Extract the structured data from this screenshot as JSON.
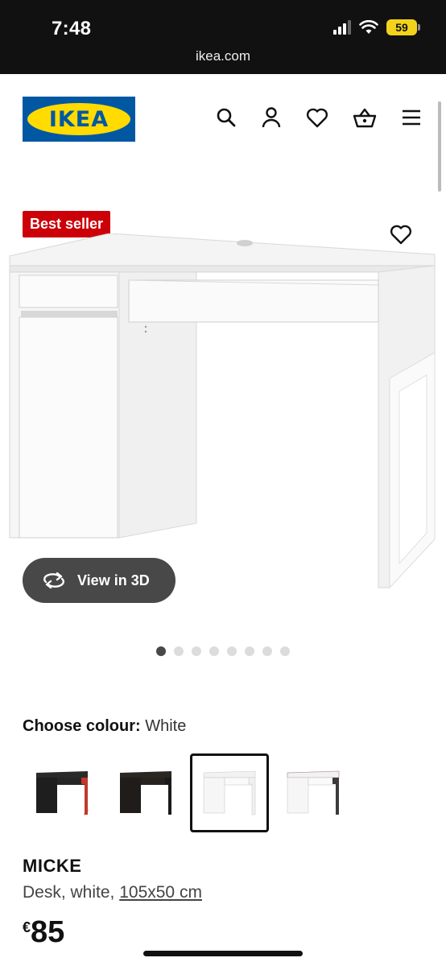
{
  "status_bar": {
    "time": "7:48",
    "battery": "59",
    "url": "ikea.com"
  },
  "header": {
    "logo_text": "IKEA",
    "icons": [
      "search-icon",
      "profile-icon",
      "heart-icon",
      "basket-icon",
      "menu-icon"
    ]
  },
  "hero": {
    "badge": "Best seller",
    "view_3d_label": "View in 3D",
    "image_count": 8,
    "active_image": 1
  },
  "colour": {
    "label": "Choose colour:",
    "value": "White",
    "options": [
      {
        "name": "black-brown/red",
        "selected": false
      },
      {
        "name": "black-brown",
        "selected": false
      },
      {
        "name": "white",
        "selected": true
      },
      {
        "name": "white/anthracite",
        "selected": false
      }
    ]
  },
  "product": {
    "name": "MICKE",
    "desc_prefix": "Desk, white, ",
    "dimensions": "105x50 cm",
    "currency": "€",
    "price": "85"
  },
  "colors": {
    "brand_blue": "#0058a3",
    "brand_yellow": "#ffdb00",
    "badge_red": "#cc0008"
  }
}
